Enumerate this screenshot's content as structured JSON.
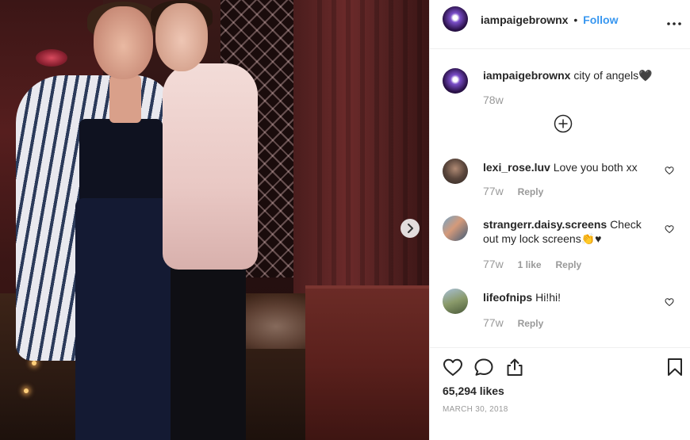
{
  "post": {
    "username": "iampaigebrownx",
    "follow_label": "Follow",
    "separator": "•",
    "caption": {
      "username": "iampaigebrownx",
      "text": "city of angels🖤",
      "time": "78w"
    },
    "comments": [
      {
        "username": "lexi_rose.luv",
        "text": "Love you both xx",
        "time": "77w",
        "reply_label": "Reply"
      },
      {
        "username": "strangerr.daisy.screens",
        "text": "Check out my lock screens👏♥",
        "time": "77w",
        "likes_label": "1 like",
        "reply_label": "Reply"
      },
      {
        "username": "lifeofnips",
        "text": "Hi!hi!",
        "time": "77w",
        "reply_label": "Reply"
      }
    ],
    "likes": "65,294 likes",
    "date": "MARCH 30, 2018"
  },
  "icons": [
    "more-options-icon",
    "load-more-icon",
    "like-icon",
    "comment-icon",
    "share-icon",
    "save-icon",
    "next-photo-icon"
  ],
  "colors": {
    "accent": "#3897f0",
    "muted": "#999999",
    "text": "#262626",
    "border": "#efefef"
  }
}
